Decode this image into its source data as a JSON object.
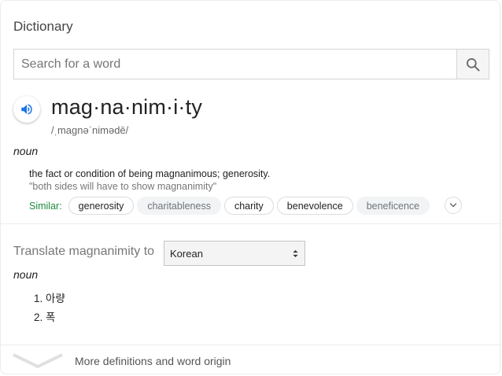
{
  "header": {
    "title": "Dictionary"
  },
  "search": {
    "placeholder": "Search for a word"
  },
  "entry": {
    "word": "mag·na·nim·i·ty",
    "pronunciation": "/ˌmaɡnəˈnimədē/",
    "part_of_speech": "noun",
    "definition": "the fact or condition of being magnanimous; generosity.",
    "example": "\"both sides will have to show magnanimity\"",
    "similar_label": "Similar:",
    "similar": [
      "generosity",
      "charitableness",
      "charity",
      "benevolence",
      "beneficence"
    ]
  },
  "translate": {
    "label": "Translate magnanimity to",
    "language": "Korean",
    "part_of_speech": "noun",
    "items": [
      "1. 아량",
      "2. 폭"
    ]
  },
  "footer": {
    "more_label": "More definitions and word origin"
  },
  "colors": {
    "accent_blue": "#1a73e8",
    "similar_green": "#1e8a3d"
  },
  "icons": [
    "search-icon",
    "speaker-icon",
    "chevron-down-icon",
    "select-arrows-icon",
    "expand-chevron-icon"
  ]
}
